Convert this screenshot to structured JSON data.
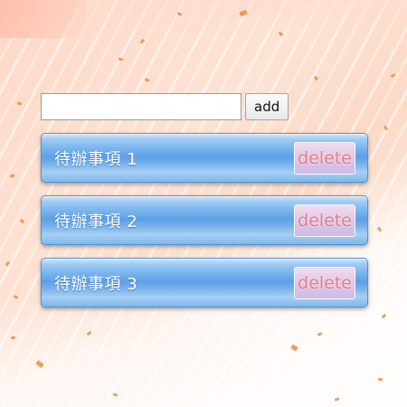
{
  "new_todo": {
    "value": "",
    "placeholder": "",
    "add_label": "add"
  },
  "todos": [
    {
      "text": "待辦事項 1",
      "delete_label": "delete"
    },
    {
      "text": "待辦事項 2",
      "delete_label": "delete"
    },
    {
      "text": "待辦事項 3",
      "delete_label": "delete"
    }
  ],
  "colors": {
    "background": "#fde6d9",
    "item_blue": "#5d9fe6",
    "delete_text": "#e8788c"
  }
}
